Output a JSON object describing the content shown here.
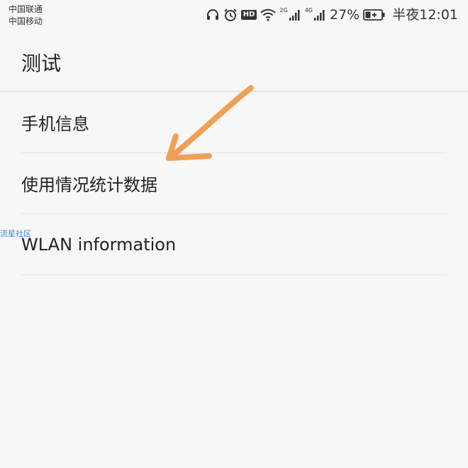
{
  "status_bar": {
    "carrier_1": "中国联通",
    "carrier_2": "中国移动",
    "hd_badge": "HD",
    "network_2g": "2G",
    "network_4g": "4G",
    "battery_percent": "27%",
    "time": "半夜12:01",
    "icons": [
      "headset-icon",
      "alarm-clock-icon",
      "hd-call-badge",
      "wifi-icon",
      "signal-2g-icon",
      "signal-4g-icon",
      "battery-charging-icon"
    ]
  },
  "header": {
    "title": "测试"
  },
  "menu": {
    "items": [
      {
        "label": "手机信息"
      },
      {
        "label": "使用情况统计数据"
      },
      {
        "label": "WLAN information"
      }
    ]
  },
  "watermark": "流星社区",
  "annotation": {
    "type": "hand-drawn-arrow",
    "color": "#f0a054",
    "points_to": "使用情况统计数据"
  }
}
